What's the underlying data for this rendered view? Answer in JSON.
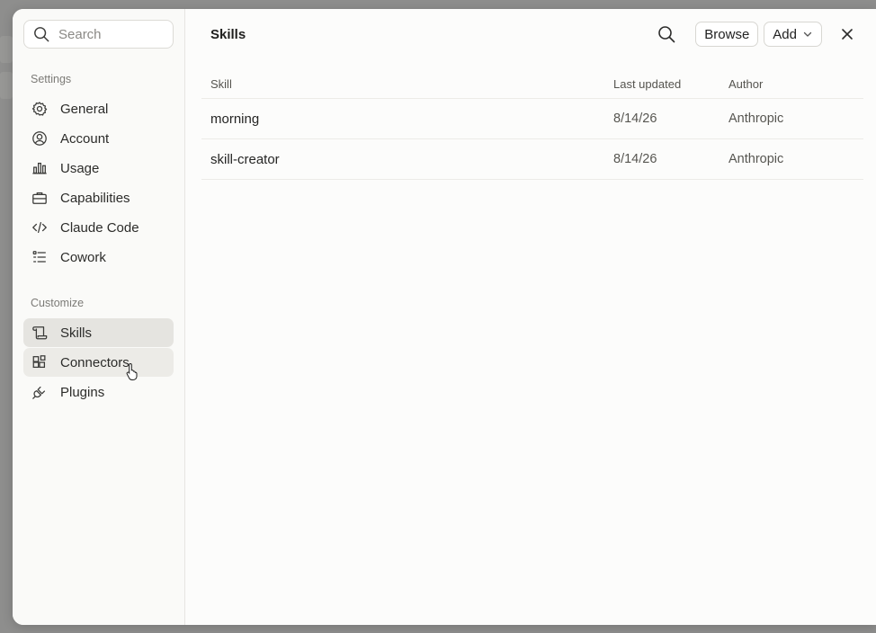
{
  "colors": {
    "backdrop": "#8e8e8d",
    "dialog_bg": "#fcfcfb",
    "active_item": "#e5e4e0",
    "hover_item": "#ecebe7"
  },
  "sidebar": {
    "search_placeholder": "Search",
    "settings_label": "Settings",
    "settings_items": [
      {
        "label": "General",
        "icon": "gear-icon"
      },
      {
        "label": "Account",
        "icon": "user-circle-icon"
      },
      {
        "label": "Usage",
        "icon": "bar-chart-icon"
      },
      {
        "label": "Capabilities",
        "icon": "briefcase-icon"
      },
      {
        "label": "Claude Code",
        "icon": "code-icon"
      },
      {
        "label": "Cowork",
        "icon": "checklist-icon"
      }
    ],
    "customize_label": "Customize",
    "customize_items": [
      {
        "label": "Skills",
        "icon": "scroll-icon",
        "state": "active"
      },
      {
        "label": "Connectors",
        "icon": "grid-plus-icon",
        "state": "hover"
      },
      {
        "label": "Plugins",
        "icon": "plug-icon"
      }
    ]
  },
  "header": {
    "title": "Skills",
    "browse_label": "Browse",
    "add_label": "Add"
  },
  "table": {
    "columns": [
      "Skill",
      "Last updated",
      "Author"
    ],
    "rows": [
      {
        "skill": "morning",
        "updated": "8/14/26",
        "author": "Anthropic"
      },
      {
        "skill": "skill-creator",
        "updated": "8/14/26",
        "author": "Anthropic"
      }
    ]
  }
}
